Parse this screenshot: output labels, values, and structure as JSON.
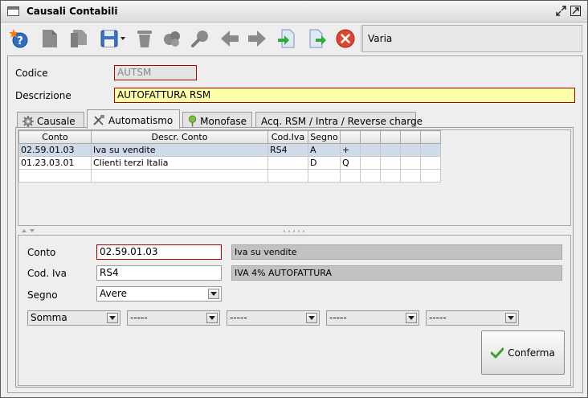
{
  "window": {
    "title": "Causali Contabili"
  },
  "toolbar": {
    "context": "Varia"
  },
  "form": {
    "codice_label": "Codice",
    "codice_value": "AUTSM",
    "descrizione_label": "Descrizione",
    "descrizione_value": "AUTOFATTURA RSM"
  },
  "tabs": [
    {
      "label": "Causale",
      "icon": "gear-icon"
    },
    {
      "label": "Automatismo",
      "icon": "tools-icon"
    },
    {
      "label": "Monofase",
      "icon": "pin-icon"
    },
    {
      "label": "Acq. RSM / Intra / Reverse charge",
      "icon": ""
    }
  ],
  "grid": {
    "columns": [
      "Conto",
      "Descr. Conto",
      "Cod.Iva",
      "Segno",
      "",
      "",
      "",
      "",
      ""
    ],
    "rows": [
      [
        "02.59.01.03",
        "Iva su vendite",
        "RS4",
        "A",
        "+",
        "",
        "",
        "",
        ""
      ],
      [
        "01.23.03.01",
        "Clienti terzi Italia",
        "",
        "D",
        "Q",
        "",
        "",
        "",
        ""
      ],
      [
        "",
        "",
        "",
        "",
        "",
        "",
        "",
        "",
        ""
      ]
    ]
  },
  "detail": {
    "conto_label": "Conto",
    "conto_value": "02.59.01.03",
    "conto_desc": "Iva su vendite",
    "codiva_label": "Cod. Iva",
    "codiva_value": "RS4",
    "codiva_desc": "IVA 4% AUTOFATTURA",
    "segno_label": "Segno",
    "segno_value": "Avere",
    "combos": [
      "Somma",
      "-----",
      "-----",
      "-----",
      "-----"
    ],
    "confirm_label": "Conferma"
  },
  "colors": {
    "required_border": "#b00000",
    "highlight_field": "#ffffa8",
    "selected_row": "#cfdbe8"
  }
}
